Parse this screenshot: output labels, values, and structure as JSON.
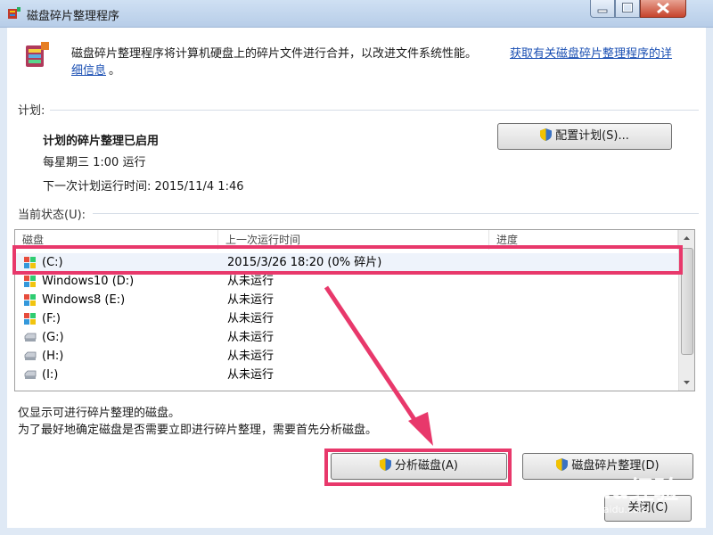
{
  "window": {
    "title": "磁盘碎片整理程序"
  },
  "intro": {
    "text_line1": "磁盘碎片整理程序将计算机硬盘上的碎片文件进行合并，以改进文件系统性能。",
    "link_line1": "获取有关磁盘碎片整理程序的详",
    "link_line2": "细信息",
    "trail": "。"
  },
  "schedule": {
    "section_label": "计划:",
    "status_title": "计划的碎片整理已启用",
    "frequency": "每星期三  1:00 运行",
    "next_run": "下一次计划运行时间: 2015/11/4 1:46",
    "configure_button": "配置计划(S)..."
  },
  "current_status": {
    "section_label": "当前状态(U):",
    "columns": [
      "磁盘",
      "上一次运行时间",
      "进度"
    ],
    "rows": [
      {
        "disk": "(C:)",
        "last_run": "2015/3/26 18:20 (0% 碎片)",
        "icon": "windows-drive-icon"
      },
      {
        "disk": "Windows10 (D:)",
        "last_run": "从未运行",
        "icon": "windows-drive-icon"
      },
      {
        "disk": "Windows8 (E:)",
        "last_run": "从未运行",
        "icon": "windows-drive-icon"
      },
      {
        "disk": "(F:)",
        "last_run": "从未运行",
        "icon": "windows-drive-icon"
      },
      {
        "disk": "(G:)",
        "last_run": "从未运行",
        "icon": "drive-icon"
      },
      {
        "disk": "(H:)",
        "last_run": "从未运行",
        "icon": "drive-icon"
      },
      {
        "disk": "(I:)",
        "last_run": "从未运行",
        "icon": "drive-icon"
      }
    ]
  },
  "notes": {
    "line1": "仅显示可进行碎片整理的磁盘。",
    "line2": "为了最好地确定磁盘是否需要立即进行碎片整理，需要首先分析磁盘。"
  },
  "actions": {
    "analyze_button": "分析磁盘(A)",
    "defrag_button": "磁盘碎片整理(D)",
    "close_button": "关闭(C)"
  },
  "watermark": {
    "brand": "Baidu经验",
    "url": "jingyan.baidu.com"
  },
  "colors": {
    "highlight": "#e8386b",
    "link": "#1a4fb3"
  }
}
